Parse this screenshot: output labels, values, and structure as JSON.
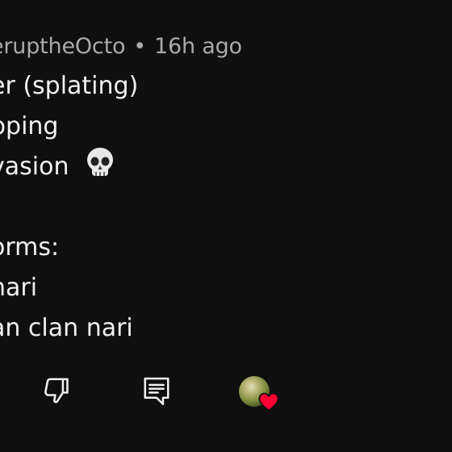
{
  "comment": {
    "author": "@ThebiggerupttheOcto",
    "author_visible": "eruptheOcto",
    "separator": "•",
    "time": "16h ago",
    "lines": [
      "er (splating)",
      "pping",
      "vasion",
      "",
      "orms:",
      "nari",
      "an clan nari"
    ]
  },
  "actions": {
    "dislike_icon": "thumbs-down-icon",
    "reply_icon": "comment-reply-icon",
    "creator_heart_icon": "creator-heart-icon"
  },
  "colors": {
    "background": "#0f0f0f",
    "text_primary": "#f1f1f1",
    "text_secondary": "#aaaaaa",
    "heart": "#ff0033"
  }
}
